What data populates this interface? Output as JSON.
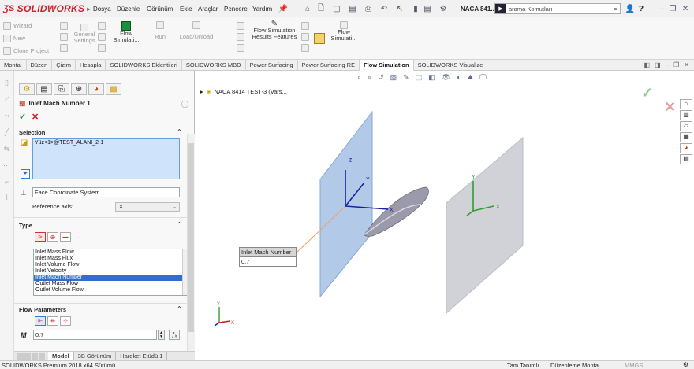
{
  "titlebar": {
    "logo_text": "SOLIDWORKS",
    "menus": [
      "Dosya",
      "Düzenle",
      "Görünüm",
      "Ekle",
      "Araçlar",
      "Pencere",
      "Yardım"
    ],
    "doc_title": "NACA 841...",
    "search_placeholder": "arama Komutları",
    "help": "?"
  },
  "ribbon": {
    "small_buttons": [
      "Wizard",
      "New",
      "Clone Project"
    ],
    "general_settings": "General Settings",
    "flow_simulation": "Flow Simulati...",
    "run": "Run",
    "load_unload": "Load/Unload",
    "flow_sim_results": "Flow Simulation Results Features",
    "flow_simulati2": "Flow Simulati..."
  },
  "tabs": [
    "Montaj",
    "Düzen",
    "Çizim",
    "Hesapla",
    "SOLIDWORKS Eklentileri",
    "SOLIDWORKS MBD",
    "Power Surfacing",
    "Power Surfacing RE",
    "Flow Simulation",
    "SOLIDWORKS Visualize"
  ],
  "active_tab": "Flow Simulation",
  "property_manager": {
    "title": "Inlet Mach Number 1",
    "selection_header": "Selection",
    "selected_face": "Yüz<1>@TEST_ALANI_2-1",
    "coord_system": "Face Coordinate System",
    "reference_axis_label": "Reference axis:",
    "reference_axis_value": "X",
    "type_header": "Type",
    "type_list": [
      "Inlet Mass Flow",
      "Inlet Mass Flux",
      "Inlet Volume Flow",
      "Inlet Velocity",
      "Inlet Mach Number",
      "Outlet Mass Flow",
      "Outlet Volume Flow"
    ],
    "type_selected": "Inlet Mach Number",
    "flow_params_header": "Flow Parameters",
    "param_symbol": "M",
    "param_value": "0.7"
  },
  "bottom_tabs": [
    "Model",
    "3B Görünüm",
    "Hareket Etüdü 1"
  ],
  "viewport": {
    "tree_root": "NACA 8414 TEST-3  (Vars...",
    "callout_title": "Inlet Mach Number",
    "callout_value": "0.7",
    "axis_x": "X",
    "axis_y": "Y",
    "axis_z": "Z"
  },
  "status": {
    "left": "SOLIDWORKS Premium 2018 x64 Sürümü",
    "defined": "Tam Tanımlı",
    "mode": "Düzenleme Montaj",
    "units": "MMGS"
  },
  "colors": {
    "accent": "#d0202a",
    "selection_blue": "#2f6fd3",
    "plane_blue": "#aac4e6",
    "plane_gray": "#c9c9d2"
  }
}
